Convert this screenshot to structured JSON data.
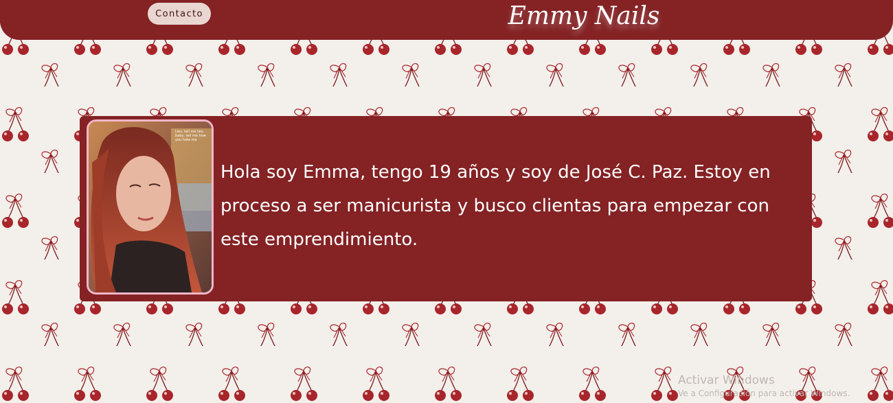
{
  "header": {
    "contact_label": "Contacto",
    "brand": "Emmy Nails"
  },
  "main": {
    "bio": "Hola soy Emma, tengo 19 años y soy de José C. Paz. Estoy en proceso a ser manicurista y busco clientas para empezar con este emprendimiento.",
    "photo_caption": "Lies, tell me lies, baby, tell me how you hate me"
  },
  "watermark": {
    "title": "Activar Windows",
    "subtitle": "Ve a Configuración para activar Windows."
  },
  "colors": {
    "brand_red": "#842224",
    "page_bg": "#f3efeb",
    "cherry": "#a8262b",
    "button_bg": "#ead6d1",
    "photo_border": "#f2b6c9"
  },
  "icons": {
    "background_motif": "cherry-bow-icon"
  }
}
